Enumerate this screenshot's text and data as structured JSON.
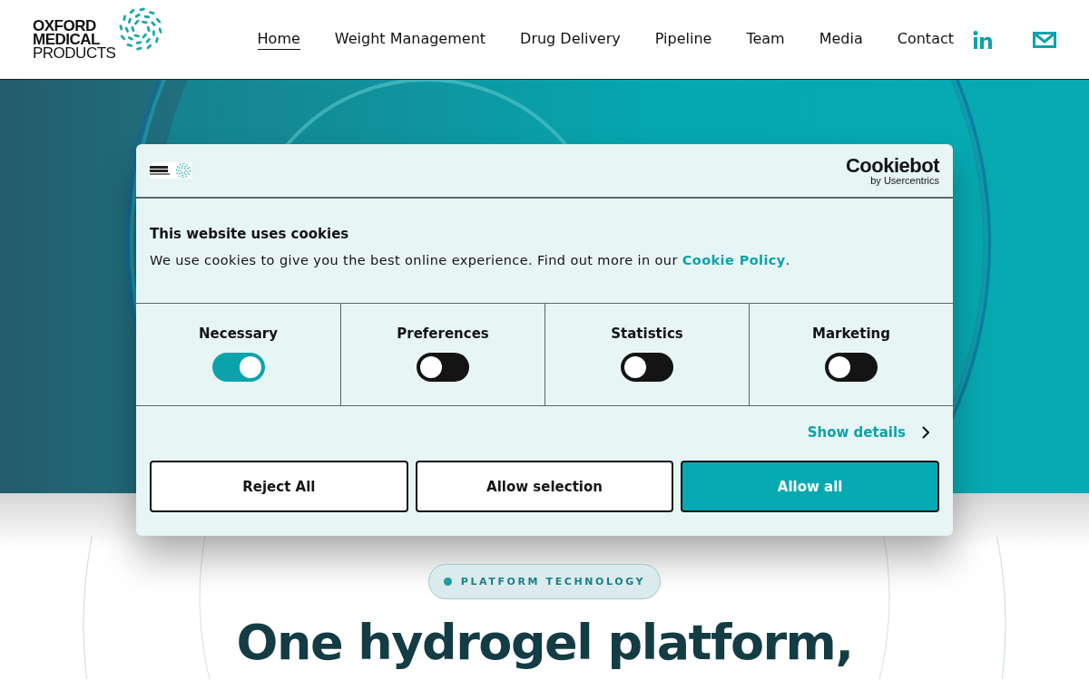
{
  "header": {
    "logo": {
      "lines": [
        "OXFORD",
        "MEDICAL",
        "PRODUCTS"
      ]
    },
    "nav": [
      {
        "label": "Home",
        "selected": true
      },
      {
        "label": "Weight Management",
        "selected": false
      },
      {
        "label": "Drug Delivery",
        "selected": false
      },
      {
        "label": "Pipeline",
        "selected": false
      },
      {
        "label": "Team",
        "selected": false
      },
      {
        "label": "Media",
        "selected": false
      },
      {
        "label": "Contact",
        "selected": false
      }
    ]
  },
  "cookie_dialog": {
    "brand": {
      "name": "Cookiebot",
      "byline": "by Usercentrics"
    },
    "title": "This website uses cookies",
    "text": "We use cookies to give you the best online experience. Find out more in our ",
    "link": "Cookie Policy",
    "text_end": ".",
    "categories": [
      {
        "label": "Necessary",
        "on": true
      },
      {
        "label": "Preferences",
        "on": false
      },
      {
        "label": "Statistics",
        "on": false
      },
      {
        "label": "Marketing",
        "on": false
      }
    ],
    "details_link": "Show details",
    "buttons": [
      {
        "label": "Reject All",
        "kind": "outline"
      },
      {
        "label": "Allow selection",
        "kind": "outline"
      },
      {
        "label": "Allow all",
        "kind": "primary"
      }
    ]
  },
  "section": {
    "badge": "PLATFORM TECHNOLOGY",
    "heading": "One hydrogel platform,"
  }
}
